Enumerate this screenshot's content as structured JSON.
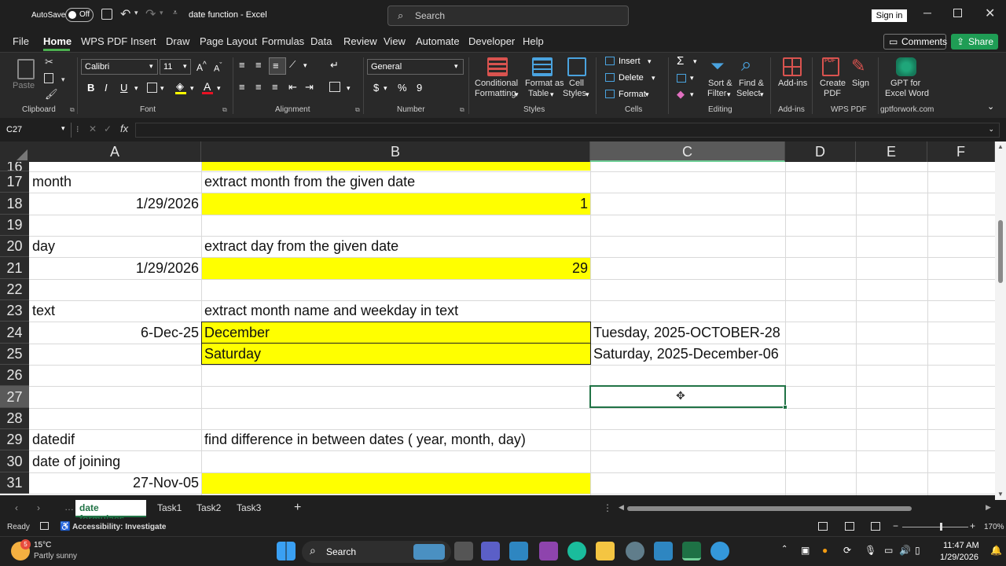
{
  "titlebar": {
    "autosave_label": "AutoSave",
    "autosave_state": "Off",
    "doc_title": "date function - Excel",
    "search_placeholder": "Search",
    "signin_label": "Sign in"
  },
  "menu": {
    "items": [
      "File",
      "Home",
      "WPS PDF",
      "Insert",
      "Draw",
      "Page Layout",
      "Formulas",
      "Data",
      "Review",
      "View",
      "Automate",
      "Developer",
      "Help"
    ],
    "active": "Home",
    "comments_label": "Comments",
    "share_label": "Share"
  },
  "ribbon": {
    "clipboard": {
      "paste": "Paste",
      "group": "Clipboard"
    },
    "font": {
      "name": "Calibri",
      "size": "11",
      "group": "Font"
    },
    "alignment": {
      "group": "Alignment"
    },
    "number": {
      "format": "General",
      "group": "Number"
    },
    "styles": {
      "conditional": "Conditional",
      "conditional2": "Formatting",
      "format_table": "Format as",
      "format_table2": "Table",
      "cell_styles": "Cell",
      "cell_styles2": "Styles",
      "group": "Styles"
    },
    "cells": {
      "insert": "Insert",
      "delete": "Delete",
      "format": "Format",
      "group": "Cells"
    },
    "editing": {
      "sort": "Sort &",
      "sort2": "Filter",
      "find": "Find &",
      "find2": "Select",
      "group": "Editing"
    },
    "addins": {
      "label": "Add-ins",
      "group": "Add-ins"
    },
    "wps": {
      "create": "Create",
      "create2": "PDF",
      "sign": "Sign",
      "group": "WPS PDF"
    },
    "gpt": {
      "label1": "GPT for",
      "label2": "Excel Word",
      "group": "gptforwork.com"
    }
  },
  "formula_bar": {
    "name_box": "C27",
    "fx": "fx",
    "content": ""
  },
  "columns": [
    "A",
    "B",
    "C",
    "D",
    "E",
    "F"
  ],
  "rows": [
    {
      "num": "16",
      "a": "",
      "b": "",
      "c": ""
    },
    {
      "num": "17",
      "a": "month",
      "b": "extract month from the given date",
      "c": ""
    },
    {
      "num": "18",
      "a": "1/29/2026",
      "b": "1",
      "c": ""
    },
    {
      "num": "19",
      "a": "",
      "b": "",
      "c": ""
    },
    {
      "num": "20",
      "a": "day",
      "b": "extract day from the given date",
      "c": ""
    },
    {
      "num": "21",
      "a": "1/29/2026",
      "b": "29",
      "c": ""
    },
    {
      "num": "22",
      "a": "",
      "b": "",
      "c": ""
    },
    {
      "num": "23",
      "a": "text",
      "b": "extract month name and weekday in text",
      "c": ""
    },
    {
      "num": "24",
      "a": "6-Dec-25",
      "b": "December",
      "c": "Tuesday, 2025-OCTOBER-28"
    },
    {
      "num": "25",
      "a": "",
      "b": "Saturday",
      "c": "Saturday, 2025-December-06"
    },
    {
      "num": "26",
      "a": "",
      "b": "",
      "c": ""
    },
    {
      "num": "27",
      "a": "",
      "b": "",
      "c": ""
    },
    {
      "num": "28",
      "a": "",
      "b": "",
      "c": ""
    },
    {
      "num": "29",
      "a": "datedif",
      "b": "find difference in between dates ( year, month, day)",
      "c": ""
    },
    {
      "num": "30",
      "a": "date of joining",
      "b": "",
      "c": ""
    },
    {
      "num": "31",
      "a": "27-Nov-05",
      "b": "",
      "c": ""
    }
  ],
  "sheets": {
    "tabs": [
      "date formulaes",
      "Task1",
      "Task2",
      "Task3"
    ],
    "active": "date formulaes"
  },
  "status": {
    "ready": "Ready",
    "accessibility": "Accessibility: Investigate",
    "zoom": "170%"
  },
  "taskbar": {
    "weather_temp": "15°C",
    "weather_desc": "Partly sunny",
    "search_label": "Search",
    "time": "11:47 AM",
    "date": "1/29/2026"
  },
  "colors": {
    "highlight": "#ffff00",
    "selection": "#217346",
    "accent_green": "#1f9d55"
  }
}
